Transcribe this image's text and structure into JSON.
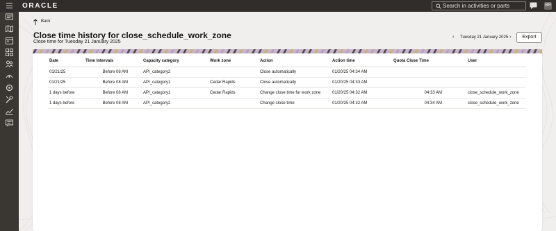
{
  "app": {
    "logo": "ORACLE",
    "search_placeholder": "Search in activities or parts",
    "avatar_initials": "BR"
  },
  "sidebar": {
    "icons": [
      "dashboard-icon",
      "map-icon",
      "calendar-icon",
      "grid-icon",
      "people-icon",
      "route-icon",
      "settings-icon",
      "tools-icon",
      "analytics-icon",
      "message-icon"
    ]
  },
  "header": {
    "back_label": "Back",
    "title": "Close time history for close_schedule_work_zone",
    "subtitle": "Close time for Tuesday 21 January 2025",
    "date_prev": "‹",
    "date_label": "Tuesday 21 January 2025",
    "date_next": "›",
    "export_label": "Export"
  },
  "table": {
    "columns": [
      "Date",
      "Time Intervals",
      "Capacity category",
      "Work zone",
      "Action",
      "Action time",
      "Quota Close Time",
      "User"
    ],
    "rows": [
      [
        "01/21/25",
        "Before 08 AM",
        "API_category2",
        "",
        "Close automatically",
        "01/20/25 04:34 AM",
        "",
        ""
      ],
      [
        "01/21/25",
        "Before 08 AM",
        "API_category1",
        "Cedar Rapids",
        "Close automatically",
        "01/20/25 04:33 AM",
        "",
        ""
      ],
      [
        "1 days before",
        "Before 08 AM",
        "API_category1",
        "Cedar Rapids",
        "Change close time for work zone",
        "01/20/25 04:32 AM",
        "04:33 AM",
        "close_schedule_work_zone"
      ],
      [
        "1 days before",
        "Before 08 AM",
        "API_category2",
        "",
        "Change close time",
        "01/20/25 04:32 AM",
        "04:34 AM",
        "close_schedule_work_zone"
      ]
    ]
  },
  "colors": {
    "topbar": "#312d2a",
    "sidebar": "#3a3632",
    "background": "#f1efed",
    "band_purple": "#b49ab9",
    "band_gold": "#c8b44a",
    "band_dark": "#3a3632"
  }
}
